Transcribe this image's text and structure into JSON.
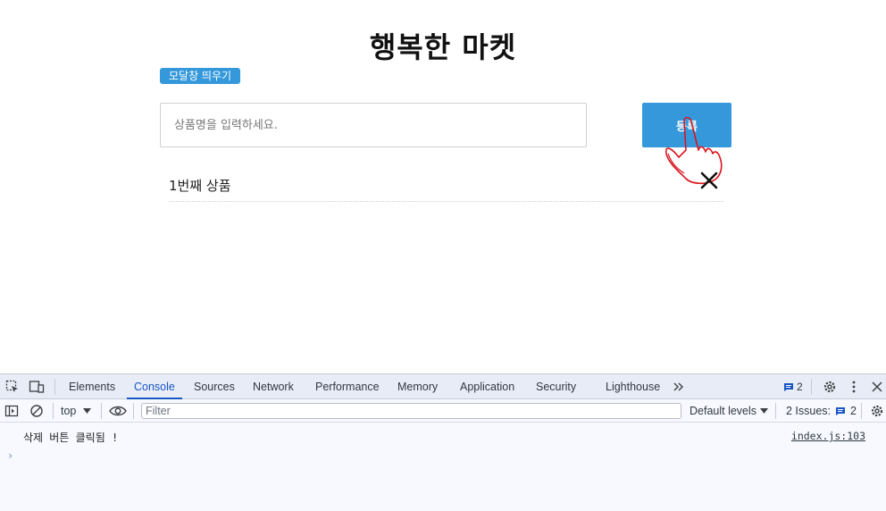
{
  "page": {
    "title": "행복한 마켓",
    "modal_button_label": "모달창 띄우기",
    "input_placeholder": "상품명을 입력하세요.",
    "add_button_label": "등록",
    "items": [
      {
        "name": "1번째 상품",
        "delete_icon": "close-icon"
      }
    ],
    "accent_color": "#3498db"
  },
  "devtools": {
    "tabs": [
      "Elements",
      "Console",
      "Sources",
      "Network",
      "Performance",
      "Memory",
      "Application",
      "Security",
      "Lighthouse"
    ],
    "active_tab": "Console",
    "more_tabs_icon": "double-chevron-icon",
    "issues_badge_count": "2",
    "toolbar": {
      "context": "top",
      "filter_placeholder": "Filter",
      "levels_label": "Default levels",
      "issues_label": "2 Issues:",
      "issues_count": "2"
    },
    "log": [
      {
        "message": "삭제 버튼 클릭됨 !",
        "source": "index.js:103"
      }
    ],
    "prompt_symbol": "›",
    "accent_color": "#1a57c5"
  }
}
